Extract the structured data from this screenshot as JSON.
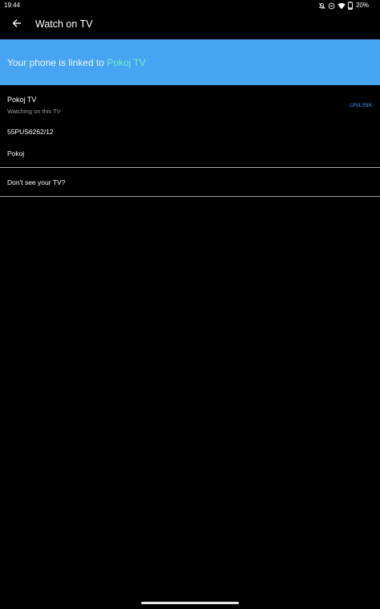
{
  "status_bar": {
    "time": "19:44",
    "battery": "20%",
    "icons": [
      "mute-icon",
      "do-not-disturb-icon",
      "wifi-icon",
      "battery-icon"
    ]
  },
  "app_bar": {
    "title": "Watch on TV",
    "back_icon": "arrow-left-icon"
  },
  "banner": {
    "prefix": "Your phone is linked to ",
    "tv_name": "Pokoj TV",
    "background_color": "#47a4f2",
    "highlight_color": "#6ff0c8"
  },
  "device": {
    "name": "Pokoj TV",
    "status": "Watching on this TV",
    "unlink_label": "UNLINK",
    "model": "55PUS6262/12",
    "room": "Pokoj"
  },
  "help": {
    "label": "Don't see your TV?"
  }
}
